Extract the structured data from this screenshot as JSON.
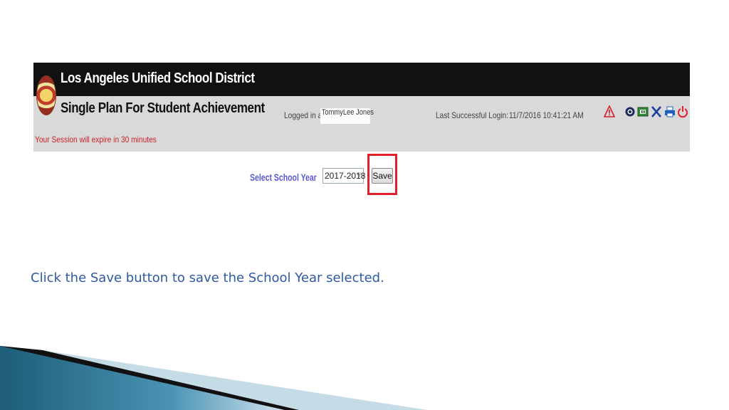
{
  "header": {
    "district_name": "Los Angeles Unified School District",
    "app_name": "Single Plan For Student Achievement",
    "session_notice": "Your Session will expire in 30 minutes",
    "logged_in_label": "Logged in as:",
    "logged_in_user": "TommyLee Jones",
    "last_login_label": "Last Successful Login:",
    "last_login_value": "11/7/2016 10:41:21 AM"
  },
  "toolbar": {
    "icons": [
      "warning-icon",
      "help-icon",
      "calendar-icon",
      "tools-icon",
      "print-icon",
      "power-icon"
    ],
    "colors": {
      "warning": "#d0202a",
      "help": "#1b2a5a",
      "calendar": "#2f8a3a",
      "tools": "#1f3fa0",
      "print": "#2060c0",
      "power": "#e0202a"
    }
  },
  "form": {
    "select_label": "Select School Year",
    "selected_year": "2017-2018",
    "save_label": "Save"
  },
  "instruction": "Click the Save button to save the School Year selected.",
  "colors": {
    "highlight": "#e0202a",
    "header_dark": "#111111",
    "header_light": "#d9d9d9",
    "instruction": "#2f5aa0"
  }
}
